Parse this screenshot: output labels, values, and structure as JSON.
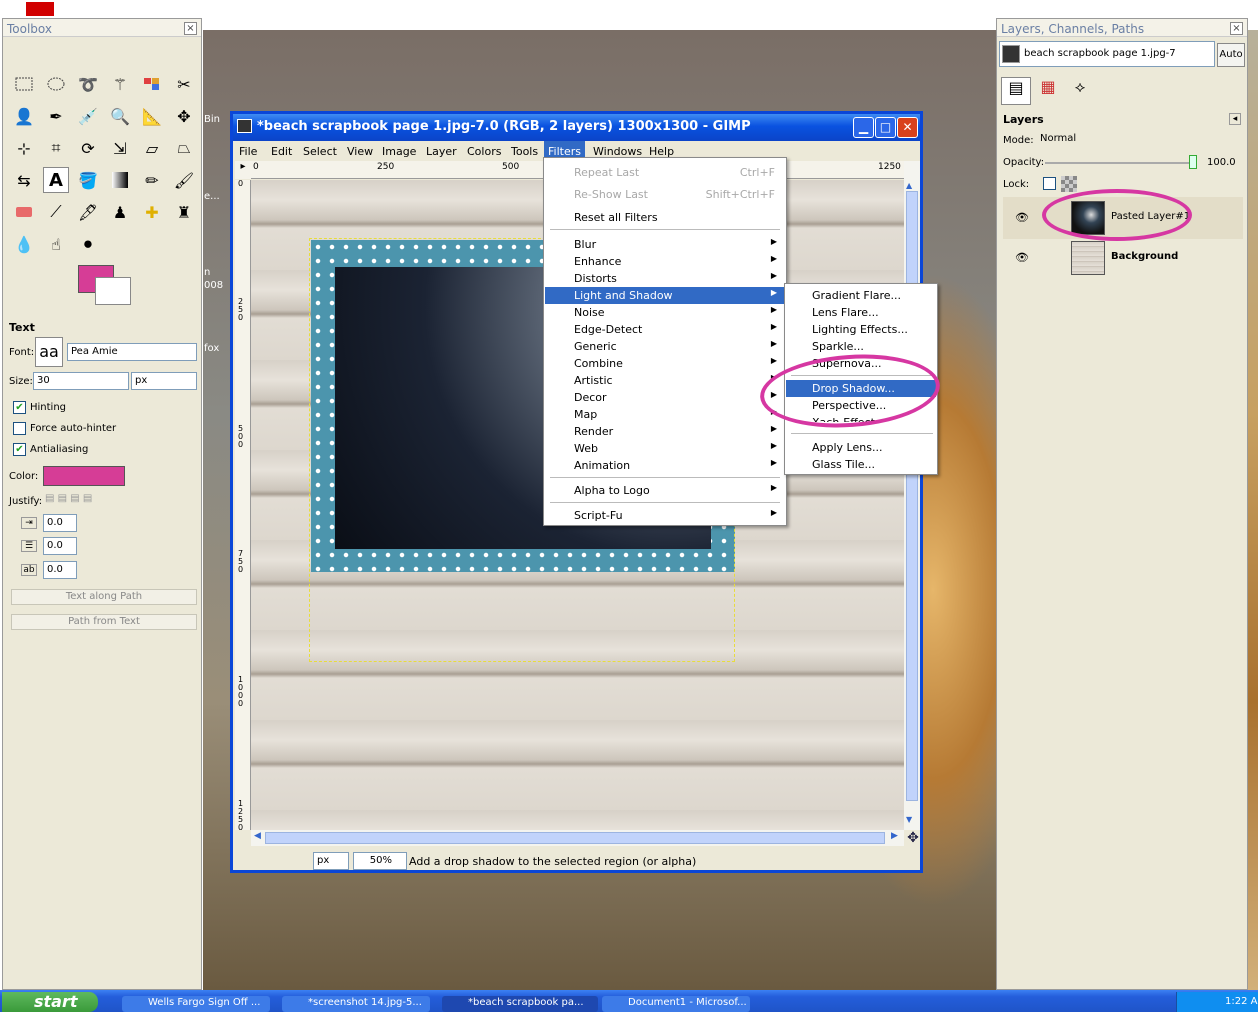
{
  "toolbox": {
    "title": "Toolbox",
    "close": "×",
    "text_panel": {
      "header": "Text",
      "font_label": "Font:",
      "font_preview": "aa",
      "font_value": "Pea Amie",
      "size_label": "Size:",
      "size_value": "30",
      "size_unit": "px",
      "hinting": "Hinting",
      "force_autohinter": "Force auto-hinter",
      "antialiasing": "Antialiasing",
      "color_label": "Color:",
      "color_value": "#d63d96",
      "justify_label": "Justify:",
      "indent": "0.0",
      "line_spacing": "0.0",
      "letter_spacing": "0.0",
      "text_along_path": "Text along Path",
      "path_from_text": "Path from Text"
    },
    "fg_color": "#d63d96",
    "bg_color": "#ffffff"
  },
  "desktop_fragments": {
    "bin": "Bin",
    "e": "e...",
    "n": "n",
    "year": "008",
    "fox": "fox"
  },
  "gimp": {
    "title": "*beach scrapbook page 1.jpg-7.0 (RGB, 2 layers) 1300x1300 - GIMP",
    "menu": [
      "File",
      "Edit",
      "Select",
      "View",
      "Image",
      "Layer",
      "Colors",
      "Tools",
      "Filters",
      "Windows",
      "Help"
    ],
    "active_menu": "Filters",
    "ruler_x": [
      "0",
      "250",
      "500",
      "1250"
    ],
    "ruler_y": [
      "0",
      "250",
      "500",
      "750",
      "1000",
      "1250"
    ],
    "unit": "px",
    "zoom": "50%",
    "status_text": "Add a drop shadow to the selected region (or alpha)"
  },
  "filters_menu": {
    "repeat_last": "Repeat Last",
    "repeat_shortcut": "Ctrl+F",
    "reshow_last": "Re-Show Last",
    "reshow_shortcut": "Shift+Ctrl+F",
    "reset_all": "Reset all Filters",
    "items": [
      "Blur",
      "Enhance",
      "Distorts",
      "Light and Shadow",
      "Noise",
      "Edge-Detect",
      "Generic",
      "Combine",
      "Artistic",
      "Decor",
      "Map",
      "Render",
      "Web",
      "Animation"
    ],
    "alpha_to_logo": "Alpha to Logo",
    "script_fu": "Script-Fu"
  },
  "light_shadow_submenu": {
    "group1": [
      "Gradient Flare...",
      "Lens Flare...",
      "Lighting Effects...",
      "Sparkle...",
      "Supernova..."
    ],
    "group2": [
      "Drop Shadow...",
      "Perspective...",
      "Xach-Effect..."
    ],
    "group3": [
      "Apply Lens...",
      "Glass Tile..."
    ],
    "highlighted": "Drop Shadow..."
  },
  "layers_dock": {
    "title": "Layers, Channels, Paths",
    "image_select": "beach scrapbook page 1.jpg-7",
    "auto": "Auto",
    "header": "Layers",
    "mode_label": "Mode:",
    "mode_value": "Normal",
    "opacity_label": "Opacity:",
    "opacity_value": "100.0",
    "lock_label": "Lock:",
    "layers": [
      {
        "name": "Pasted Layer#1",
        "selected": true
      },
      {
        "name": "Background",
        "selected": false
      }
    ]
  },
  "taskbar": {
    "start": "start",
    "tasks": [
      "Wells Fargo Sign Off ...",
      "*screenshot 14.jpg-5...",
      "*beach scrapbook pa...",
      "Document1 - Microsof..."
    ],
    "clock": "1:22 A"
  },
  "colors": {
    "highlight": "#316ac5",
    "annotation": "#d637a2",
    "xp_blue": "#0a46d8"
  }
}
